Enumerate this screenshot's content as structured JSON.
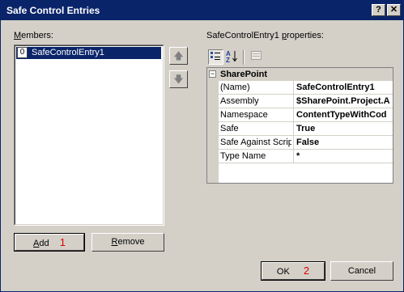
{
  "window": {
    "title": "Safe Control Entries"
  },
  "titlebar": {
    "help_label": "?",
    "close_label": "✕"
  },
  "members": {
    "label": "Members:",
    "label_accel": "M",
    "label_rest": "embers:",
    "items": [
      {
        "index": "0",
        "name": "SafeControlEntry1"
      }
    ]
  },
  "arrows": {
    "up_label": "🡅",
    "down_label": "🡇"
  },
  "add_button": {
    "accel": "A",
    "rest": "dd",
    "mark": "1"
  },
  "remove_button": {
    "accel": "R",
    "rest": "emove"
  },
  "properties": {
    "label_before": "SafeControlEntry1 ",
    "label_accel": "p",
    "label_after": "roperties:",
    "toolbar": {
      "categorized_icon": "categorized-icon",
      "alphabetical_icon": "alphabetical-icon",
      "property_pages_icon": "property-pages-icon"
    },
    "category": {
      "expander": "−",
      "name": "SharePoint"
    },
    "rows": [
      {
        "name": "(Name)",
        "value": "SafeControlEntry1"
      },
      {
        "name": "Assembly",
        "value": "$SharePoint.Project.A"
      },
      {
        "name": "Namespace",
        "value": "ContentTypeWithCod"
      },
      {
        "name": "Safe",
        "value": "True"
      },
      {
        "name": "Safe Against Scrip",
        "value": "False"
      },
      {
        "name": "Type Name",
        "value": "*"
      }
    ]
  },
  "ok_button": {
    "label": "OK",
    "mark": "2"
  },
  "cancel_button": {
    "label": "Cancel"
  }
}
